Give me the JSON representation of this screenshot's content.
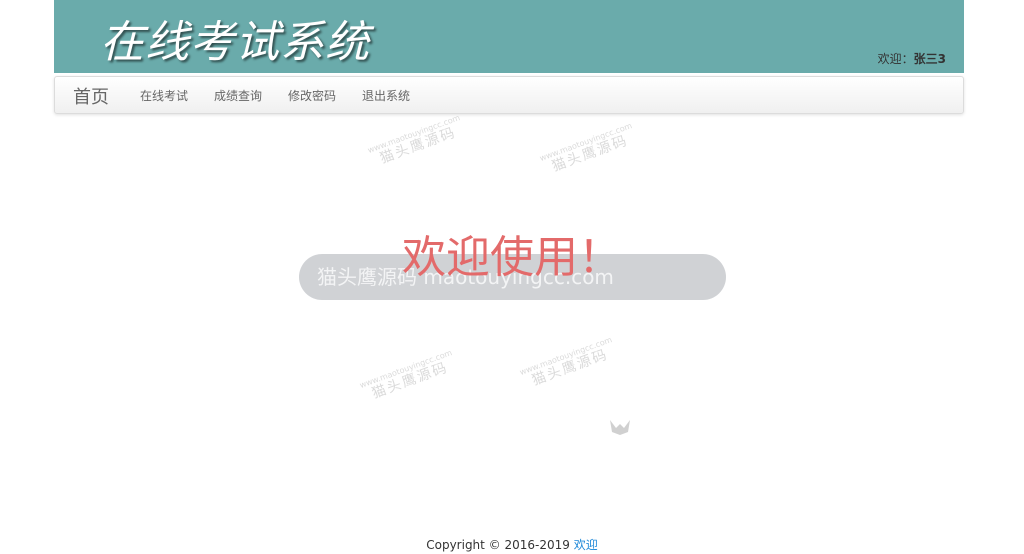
{
  "header": {
    "title": "在线考试系统",
    "welcome_label": "欢迎：",
    "user_name": "张三3"
  },
  "navbar": {
    "brand": "首页",
    "items": [
      {
        "label": "在线考试"
      },
      {
        "label": "成绩查询"
      },
      {
        "label": "修改密码"
      },
      {
        "label": "退出系统"
      }
    ]
  },
  "main": {
    "welcome": "欢迎使用！"
  },
  "watermark": {
    "site_small": "www.maotouyingcc.com",
    "site_cn": "猫头鹰源码",
    "pill_text": "猫头鹰源码 maotouyingcc.com"
  },
  "footer": {
    "copyright": "Copyright © 2016-2019",
    "link": "欢迎"
  },
  "colors": {
    "header_bg": "#6aabab",
    "welcome_text": "#e36a6a",
    "footer_link": "#1e88d8"
  }
}
